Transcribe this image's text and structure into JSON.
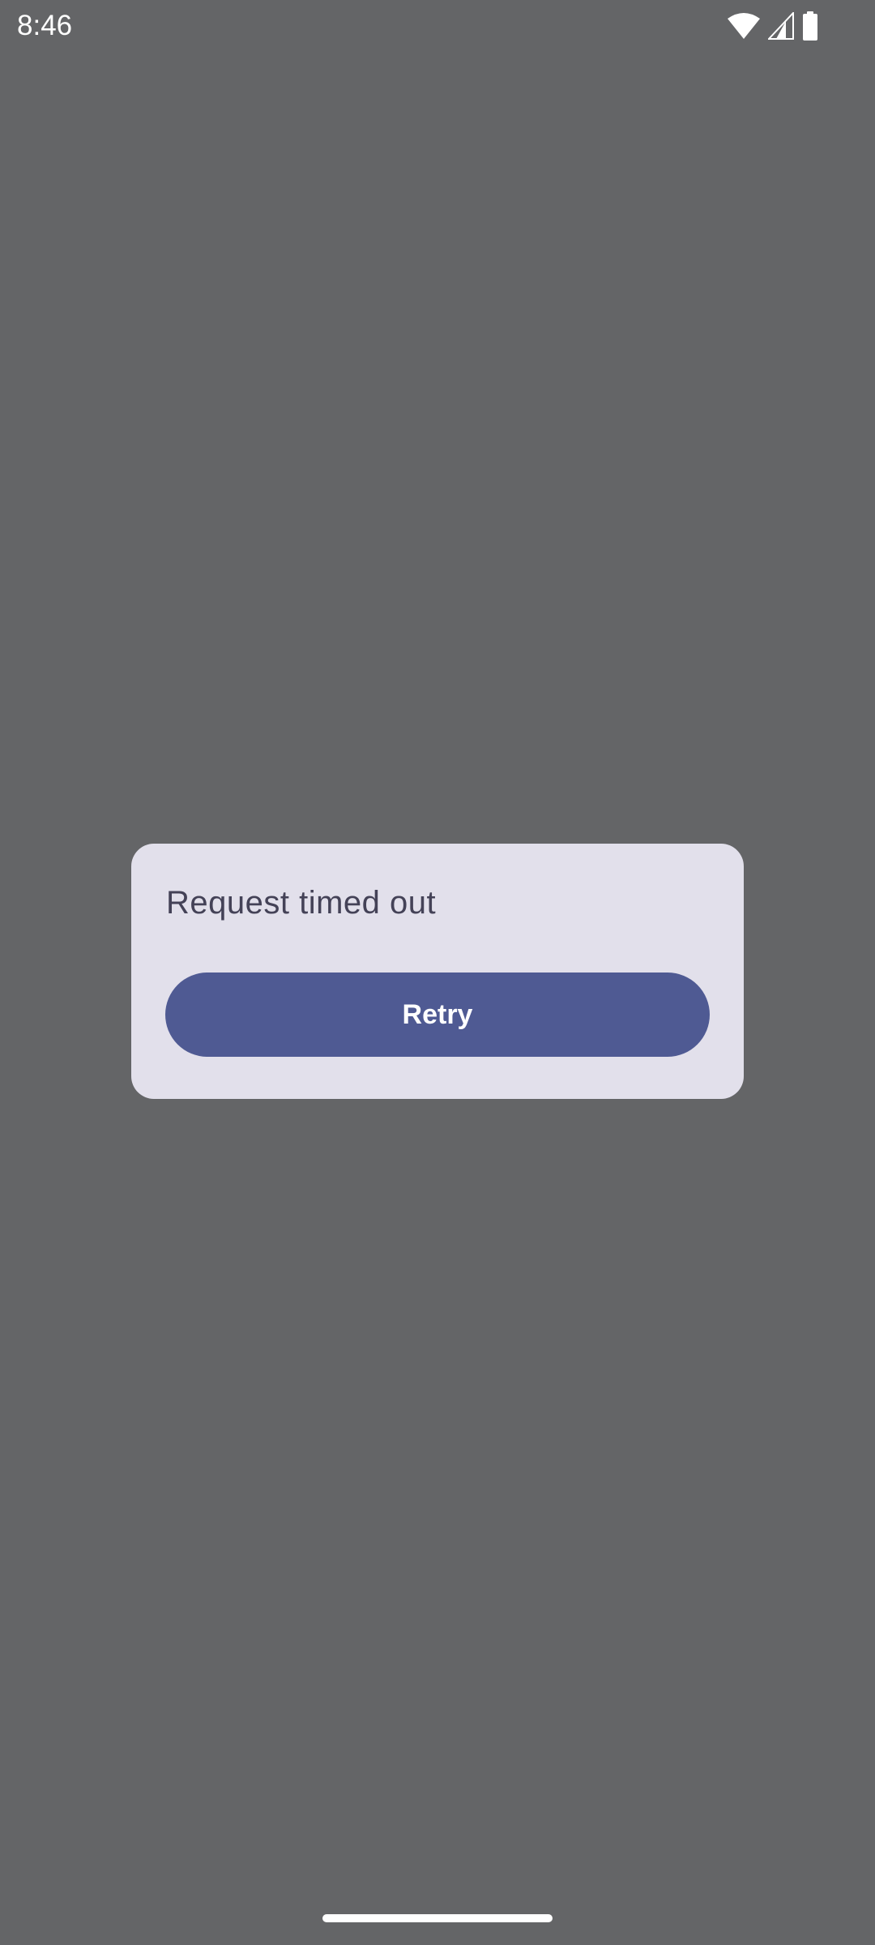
{
  "status_bar": {
    "time": "8:46",
    "icons": [
      "wifi-icon",
      "cellular-signal-icon",
      "battery-icon"
    ]
  },
  "dialog": {
    "title": "Request timed out",
    "retry_label": "Retry"
  },
  "colors": {
    "scrim_background": "#646567",
    "dialog_surface": "#e2e0eb",
    "dialog_text": "#444257",
    "button_primary": "#4f5a93",
    "button_text": "#ffffff"
  }
}
